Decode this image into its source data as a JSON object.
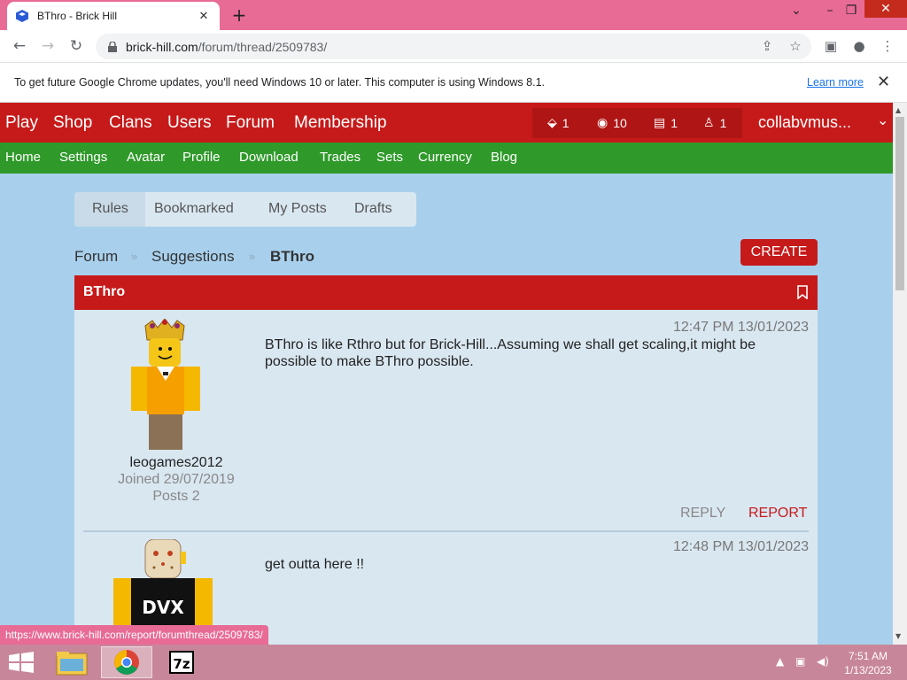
{
  "browser": {
    "tab_title": "BThro - Brick Hill",
    "url_domain": "brick-hill.com",
    "url_path": "/forum/thread/2509783/",
    "infobar_message": "To get future Google Chrome updates, you'll need Windows 10 or later. This computer is using Windows 8.1.",
    "infobar_link": "Learn more",
    "status_url": "https://www.brick-hill.com/report/forumthread/2509783/"
  },
  "site": {
    "main_nav": [
      "Play",
      "Shop",
      "Clans",
      "Users",
      "Forum",
      "Membership"
    ],
    "stats": {
      "messages": "1",
      "bucks": "10",
      "notifications": "1",
      "friends": "1"
    },
    "username": "collabvmus...",
    "sub_nav": [
      "Home",
      "Settings",
      "Avatar",
      "Profile",
      "Download",
      "Trades",
      "Sets",
      "Currency",
      "Blog"
    ]
  },
  "forum": {
    "tabs": [
      "Rules",
      "Bookmarked",
      "My Posts",
      "Drafts"
    ],
    "breadcrumb": [
      "Forum",
      "Suggestions",
      "BThro"
    ],
    "create_label": "CREATE",
    "thread_title": "BThro"
  },
  "posts": [
    {
      "time": "12:47 PM 13/01/2023",
      "body": "BThro is like Rthro but for Brick-Hill...Assuming we shall get scaling,it might be possible to make BThro possible.",
      "username": "leogames2012",
      "joined": "Joined 29/07/2019",
      "posts": "Posts 2",
      "reply": "REPLY",
      "report": "REPORT"
    },
    {
      "time": "12:48 PM 13/01/2023",
      "body": "get outta here !!"
    }
  ],
  "taskbar": {
    "time": "7:51 AM",
    "date": "1/13/2023"
  },
  "colors": {
    "brand_red": "#c61a1a",
    "brand_green": "#2f9a2a",
    "page_bg": "#a8d0ec"
  }
}
